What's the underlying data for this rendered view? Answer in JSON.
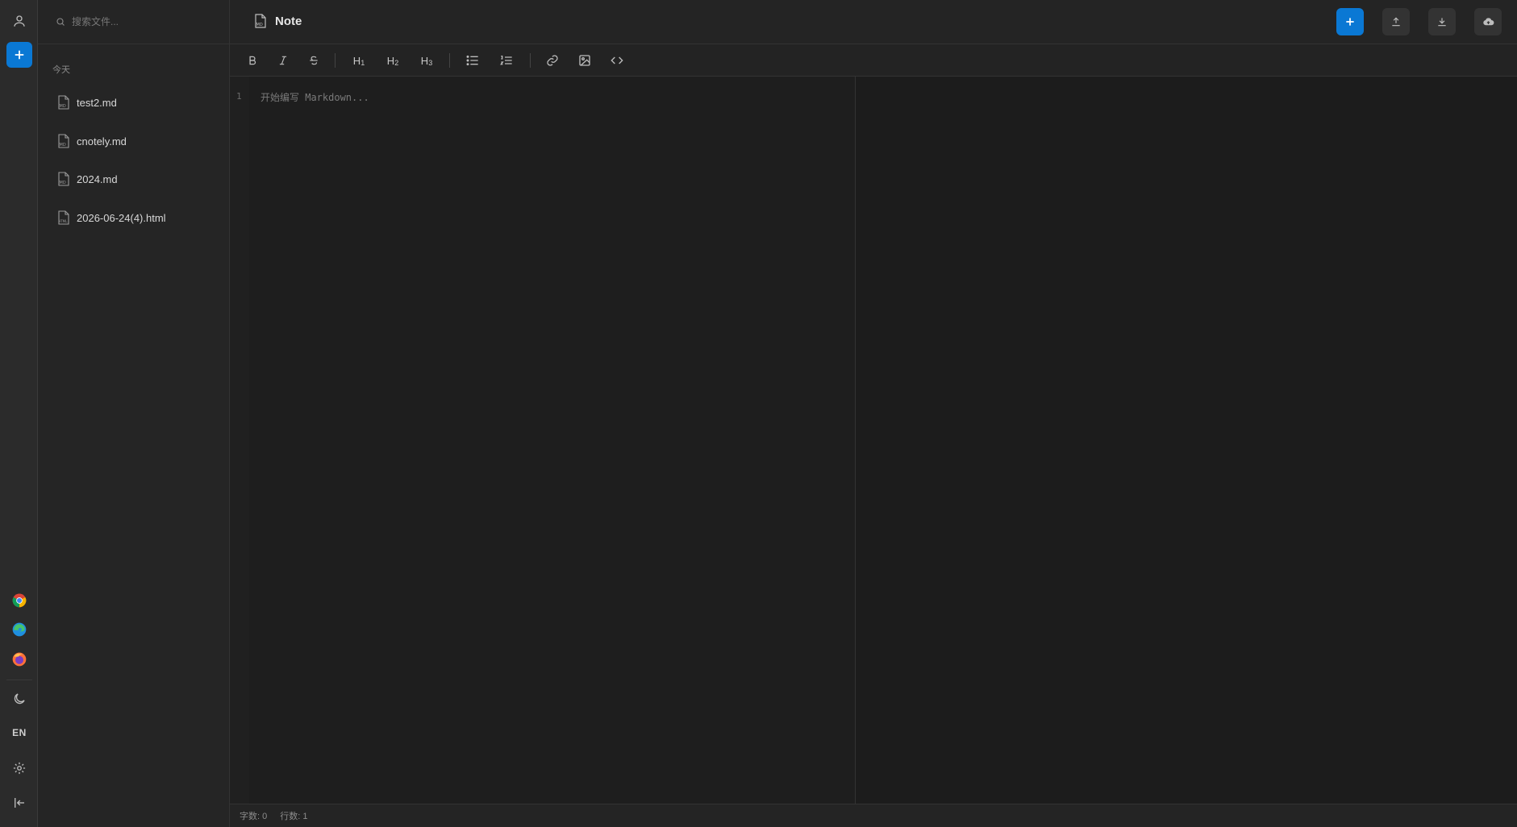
{
  "search": {
    "placeholder": "搜索文件..."
  },
  "sidebar": {
    "group_label": "今天",
    "files": [
      {
        "name": "test2.md",
        "type": "MD"
      },
      {
        "name": "cnotely.md",
        "type": "MD"
      },
      {
        "name": "2024.md",
        "type": "MD"
      },
      {
        "name": "2026-06-24(4).html",
        "type": "HTML"
      }
    ]
  },
  "rail": {
    "language": "EN"
  },
  "header": {
    "title": "Note"
  },
  "toolbar": {
    "h1": "H",
    "h2": "H",
    "h3": "H",
    "h1_sub": "1",
    "h2_sub": "2",
    "h3_sub": "3"
  },
  "editor": {
    "line_number": "1",
    "placeholder": "开始编写 Markdown..."
  },
  "status": {
    "word_count": "字数: 0",
    "line_count": "行数: 1"
  },
  "colors": {
    "accent": "#0a78d4",
    "background": "#1e1e1e"
  }
}
